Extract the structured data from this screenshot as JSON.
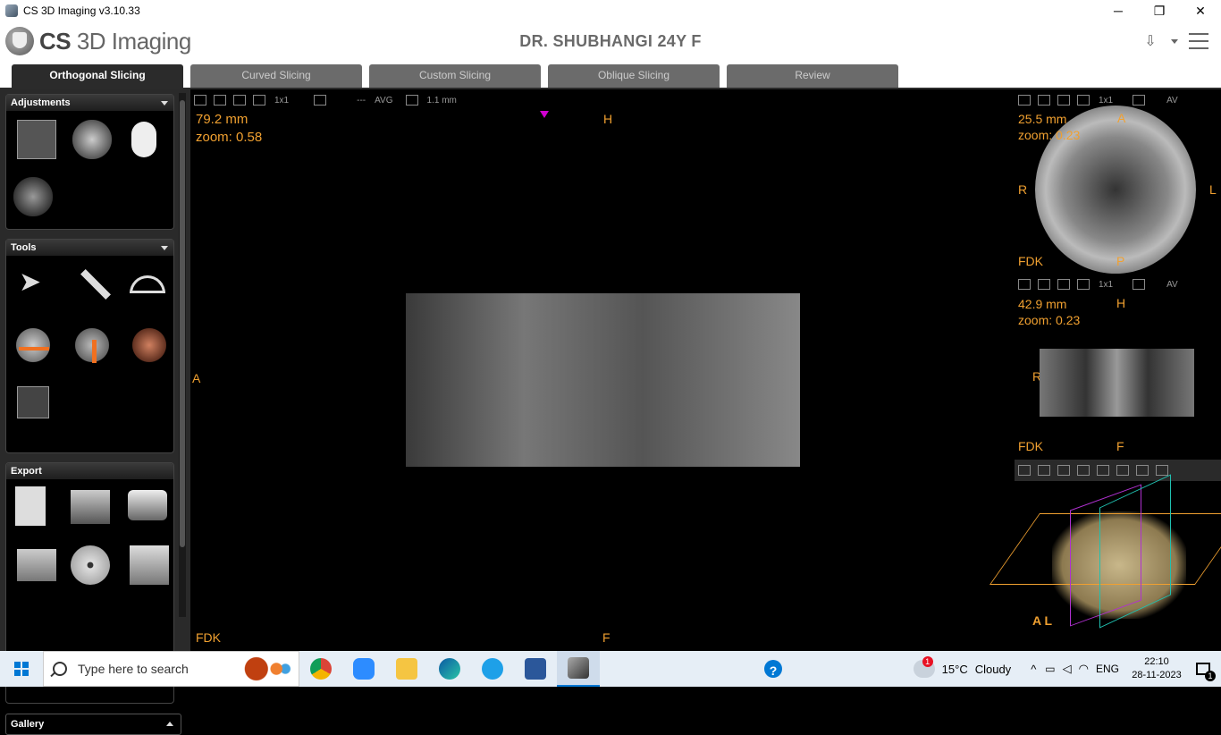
{
  "window": {
    "title": "CS 3D Imaging v3.10.33",
    "minimize": "─",
    "maximize": "❐",
    "close": "✕"
  },
  "header": {
    "logo_bold": "CS",
    "logo_rest": " 3D Imaging",
    "patient": "DR. SHUBHANGI 24Y F"
  },
  "tabs": [
    {
      "label": "Orthogonal Slicing",
      "active": true
    },
    {
      "label": "Curved Slicing"
    },
    {
      "label": "Custom Slicing"
    },
    {
      "label": "Oblique Slicing"
    },
    {
      "label": "Review"
    }
  ],
  "left": {
    "adjustments": "Adjustments",
    "tools": "Tools",
    "export": "Export",
    "gallery": "Gallery"
  },
  "main_view": {
    "layout": "1x1",
    "mode": "AVG",
    "thickness": "1.1 mm",
    "distance": "79.2 mm",
    "zoom": "zoom: 0.58",
    "top_label": "H",
    "left_label": "A",
    "bottom_label": "F",
    "corner_label": "FDK"
  },
  "axial_view": {
    "layout": "1x1",
    "mode": "AV",
    "distance": "25.5 mm",
    "zoom": "zoom: 0.23",
    "top": "A",
    "left": "R",
    "right": "L",
    "bottom": "P",
    "corner": "FDK"
  },
  "coronal_view": {
    "layout": "1x1",
    "mode": "AV",
    "distance": "42.9 mm",
    "zoom": "zoom: 0.23",
    "top": "H",
    "left": "R",
    "bottom": "F",
    "corner": "FDK"
  },
  "model_view": {
    "axis_labels": "A L"
  },
  "taskbar": {
    "search_placeholder": "Type here to search",
    "weather_temp": "15°C",
    "weather_desc": "Cloudy",
    "weather_badge": "1",
    "lang": "ENG",
    "time": "22:10",
    "date": "28-11-2023",
    "notif_count": "1"
  }
}
